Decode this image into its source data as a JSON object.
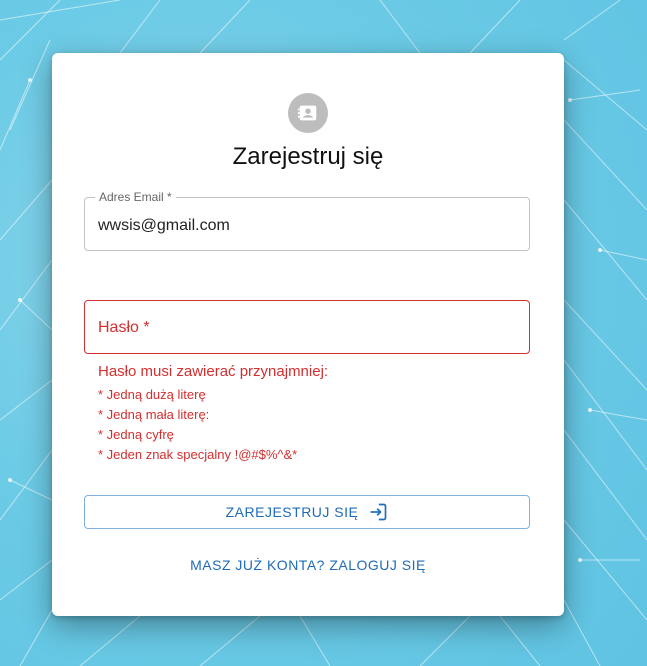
{
  "page": {
    "title": "Zarejestruj się",
    "avatar_icon": "contact-card-icon"
  },
  "email": {
    "label": "Adres Email",
    "required_mark": "*",
    "value": "wwsis@gmail.com"
  },
  "password": {
    "label": "Hasło *",
    "value": ""
  },
  "password_help": {
    "title": "Hasło musi zawierać przynajmniej:",
    "items": [
      "* Jedną dużą literę",
      "* Jedną mała literę:",
      "* Jedną cyfrę",
      "* Jeden znak specjalny !@#$%^&*"
    ]
  },
  "actions": {
    "register_label": "ZAREJESTRUJ SIĘ",
    "register_icon": "login-arrow-icon",
    "login_link": "MASZ JUŻ KONTA? ZALOGUJ SIĘ"
  },
  "colors": {
    "error": "#d32f2f",
    "primary": "#1e6bb8",
    "background": "#6ccbe6"
  }
}
